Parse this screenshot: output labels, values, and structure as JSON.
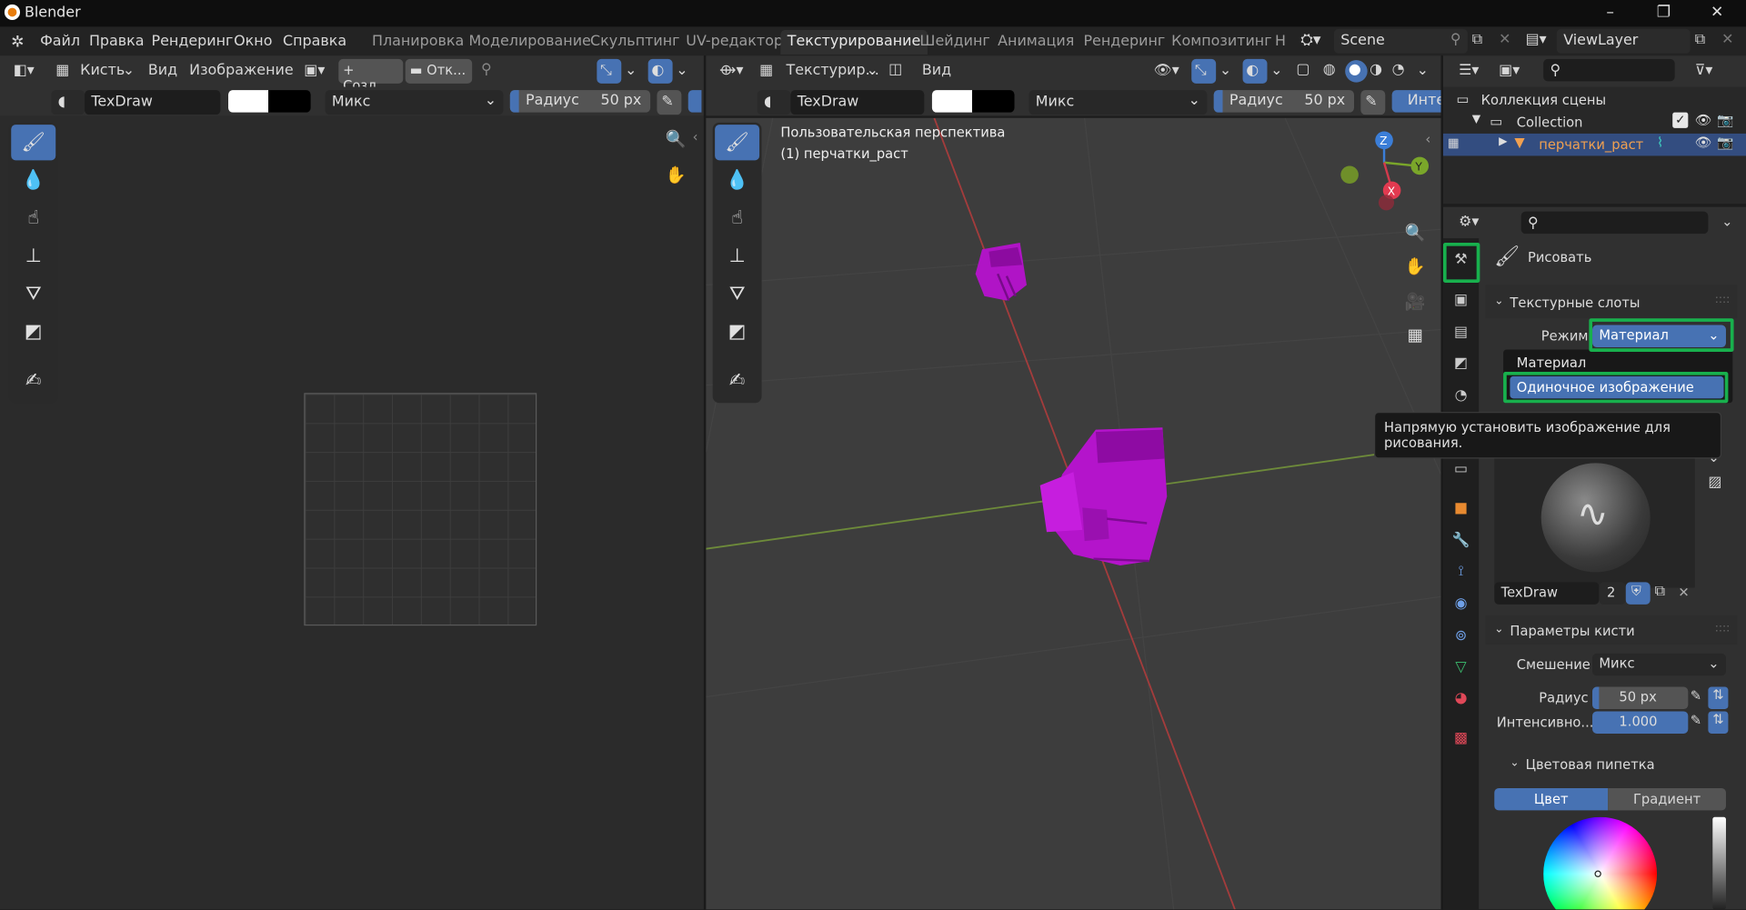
{
  "app_title": "Blender",
  "menu": [
    "Файл",
    "Правка",
    "Рендеринг",
    "Окно",
    "Справка"
  ],
  "workspaces": [
    "Планировка",
    "Моделирование",
    "Скульптинг",
    "UV-редактор",
    "Текстурирование",
    "Шейдинг",
    "Анимация",
    "Рендеринг",
    "Композитинг",
    "Н"
  ],
  "active_workspace": "Текстурирование",
  "scene_name": "Scene",
  "view_layer": "ViewLayer",
  "image_editor": {
    "mode": "Кисть",
    "menu_view": "Вид",
    "menu_image": "Изображение",
    "new_btn": "+ Созд...",
    "open_btn": "Отк...",
    "brush_name": "TexDraw",
    "blend": "Микс",
    "radius_label": "Радиус",
    "radius_value": "50 px"
  },
  "viewport": {
    "mode": "Текстурир...",
    "menu_view": "Вид",
    "brush_name": "TexDraw",
    "blend": "Микс",
    "radius_label": "Радиус",
    "radius_value": "50 px",
    "intensity_short": "Инте",
    "overlay_line1": "Пользовательская перспектива",
    "overlay_line2": "(1) перчатки_раст",
    "axes": {
      "x": "X",
      "y": "Y",
      "z": "Z"
    }
  },
  "outliner": {
    "title": "Коллекция сцены",
    "collection": "Collection",
    "object": "перчатки_раст"
  },
  "properties": {
    "tool_name": "Рисовать",
    "texture_slots": "Текстурные слоты",
    "mode_label": "Режим",
    "mode_value": "Материал",
    "dropdown_options": [
      "Материал",
      "Одиночное изображение"
    ],
    "tooltip": "Напрямую установить изображение для рисования.",
    "brush_name": "TexDraw",
    "brush_users": "2",
    "brush_settings": "Параметры кисти",
    "blend_label": "Смешение",
    "blend_value": "Микс",
    "radius_label": "Радиус",
    "radius_value": "50 px",
    "intensity_label": "Интенсивно...",
    "intensity_value": "1.000",
    "color_picker": "Цветовая пипетка",
    "tab_color": "Цвет",
    "tab_gradient": "Градиент"
  }
}
